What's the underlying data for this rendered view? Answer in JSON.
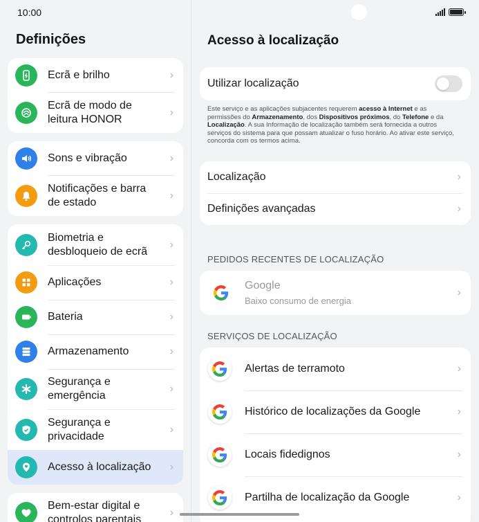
{
  "status": {
    "time": "10:00"
  },
  "left": {
    "title": "Definições",
    "groups": [
      {
        "items": [
          {
            "label": "Ecrã e brilho",
            "icon": "display-icon",
            "color": "#2bb55b"
          },
          {
            "label": "Ecrã de modo de leitura HONOR",
            "icon": "eye-comfort-icon",
            "color": "#2bb55b"
          }
        ]
      },
      {
        "items": [
          {
            "label": "Sons e vibração",
            "icon": "speaker-icon",
            "color": "#2f80e8"
          },
          {
            "label": "Notificações e barra de estado",
            "icon": "bell-icon",
            "color": "#f39c12"
          }
        ]
      },
      {
        "items": [
          {
            "label": "Biometria e desbloqueio de ecrã",
            "icon": "key-icon",
            "color": "#23b9b0"
          },
          {
            "label": "Aplicações",
            "icon": "apps-grid-icon",
            "color": "#f39c12"
          },
          {
            "label": "Bateria",
            "icon": "battery-icon",
            "color": "#2bb55b"
          },
          {
            "label": "Armazenamento",
            "icon": "storage-icon",
            "color": "#2f80e8"
          },
          {
            "label": "Segurança e emergência",
            "icon": "asterisk-icon",
            "color": "#23b9b0"
          },
          {
            "label": "Segurança e privacidade",
            "icon": "shield-check-icon",
            "color": "#23b9b0"
          },
          {
            "label": "Acesso à localização",
            "icon": "location-pin-icon",
            "color": "#23b9b0"
          }
        ]
      },
      {
        "items": [
          {
            "label": "Bem-estar digital e controlos parentais",
            "icon": "heart-icon",
            "color": "#2bb55b"
          }
        ]
      }
    ]
  },
  "right": {
    "title": "Acesso à localização",
    "use_location": {
      "label": "Utilizar localização",
      "enabled": false
    },
    "disclaimer": {
      "p1": "Este serviço e as aplicações subjacentes requerem ",
      "b1": "acesso à Internet",
      "p2": " e as permissões do ",
      "b2": "Armazenamento",
      "p3": ", dos ",
      "b3": "Dispositivos próximos",
      "p4": ", do ",
      "b4": "Telefone",
      "p5": " e da ",
      "b5": "Localização",
      "p6": ". A sua Informação de localização também será fornecida a outros serviços do sistema para que possam atualizar o fuso horário. Ao ativar este serviço, concorda com os termos acima."
    },
    "settings_rows": [
      "Localização",
      "Definições avançadas"
    ],
    "recent_header": "PEDIDOS RECENTES DE LOCALIZAÇÃO",
    "recent": {
      "name": "Google",
      "detail": "Baixo consumo de energia"
    },
    "services_header": "SERVIÇOS DE LOCALIZAÇÃO",
    "services": [
      "Alertas de terramoto",
      "Histórico de localizações da Google",
      "Locais fidedignos",
      "Partilha de localização da Google"
    ]
  }
}
